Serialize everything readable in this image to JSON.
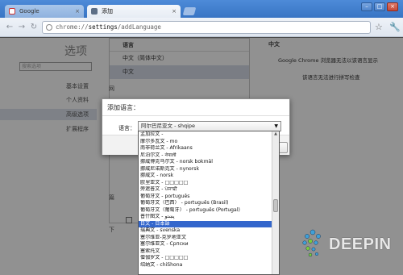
{
  "tabs": [
    {
      "label": "Google",
      "close": "×"
    },
    {
      "label": "添加",
      "close": "×"
    }
  ],
  "window_buttons": {
    "minimize": "–",
    "maximize": "□",
    "close": "×"
  },
  "toolbar": {
    "back": "←",
    "forward": "→",
    "reload": "↻",
    "url_scheme": "chrome://",
    "url_host": "settings",
    "url_path": "/addLanguage",
    "star": "☆",
    "wrench": "🔧"
  },
  "sidebar": {
    "title": "选项",
    "search_placeholder": "搜索选项",
    "items": [
      {
        "label": "基本设置"
      },
      {
        "label": "个人资料"
      },
      {
        "label": "高级选项"
      },
      {
        "label": "扩展程序"
      }
    ]
  },
  "languages_list": {
    "header": "语言",
    "rows": [
      "中文（简体中文）",
      "中文"
    ]
  },
  "language_panel": {
    "header": "中文",
    "line1": "Google Chrome 浏览器无法以该语言显示",
    "line2": "该语言无法进行拼写检查"
  },
  "side_labels": {
    "label_a": "网",
    "label_b": "篇",
    "label_c": "下"
  },
  "dialog": {
    "title": "添加语言：",
    "language_label": "语言：",
    "selected_value": "阿尔巴尼亚文 - shqipe",
    "arrow": "▼"
  },
  "dropdown": {
    "selected_index": 13,
    "options": [
      "孟加拉文 -",
      "摩尔多瓦文 - mo",
      "南非荷兰文 - Afrikaans",
      "尼泊尔文 - नेपाली",
      "挪威博克马尔文 - norsk bokmål",
      "挪威尼诺斯克文 - nynorsk",
      "挪威文 - norsk",
      "欧里亚文 - □□□□□",
      "旁遮普文 - ਪੰਜਾਬੀ",
      "葡萄牙文 - português",
      "葡萄牙文（巴西） - português (Brasil)",
      "葡萄牙文（葡萄牙） - português (Portugal)",
      "普什图文 - پښتو",
      "日文 - 日本語",
      "瑞典文 - svenska",
      "塞尔维亚-克罗地亚文",
      "塞尔维亚文 - Српски",
      "塞索托文",
      "僧伽罗文 - □□□□□",
      "绍纳文 - chiShona"
    ],
    "scroll_up": "▲"
  },
  "logo": {
    "word": "DEEPIN"
  },
  "colors": {
    "titlebar": "#3874c4",
    "selection": "#3366cc",
    "overlay": "rgba(0,0,0,0.43)"
  }
}
